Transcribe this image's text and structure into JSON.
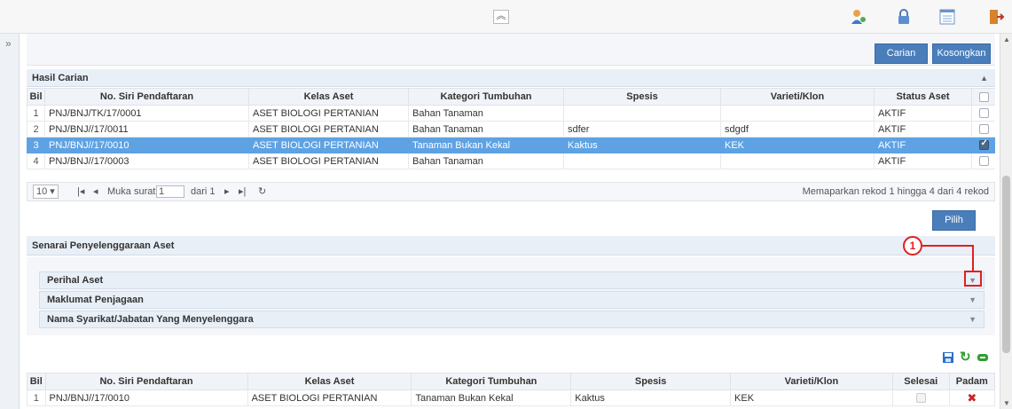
{
  "topbar": {
    "collapse_glyph": "︽",
    "icons": [
      "user-settings-icon",
      "lock-icon",
      "list-window-icon",
      "logout-icon"
    ]
  },
  "sidebar": {
    "expand_glyph": "»"
  },
  "actions": {
    "search_label": "Carian",
    "clear_label": "Kosongkan",
    "select_label": "Pilih"
  },
  "results": {
    "title": "Hasil Carian",
    "columns": [
      "Bil",
      "No. Siri Pendaftaran",
      "Kelas Aset",
      "Kategori Tumbuhan",
      "Spesis",
      "Varieti/Klon",
      "Status Aset"
    ],
    "rows": [
      {
        "bil": "1",
        "no_siri": "PNJ/BNJ/TK/17/0001",
        "kelas": "ASET BIOLOGI PERTANIAN",
        "kategori": "Bahan Tanaman",
        "spesis": "",
        "varieti": "",
        "status": "AKTIF",
        "checked": false,
        "selected": false
      },
      {
        "bil": "2",
        "no_siri": "PNJ/BNJ//17/0011",
        "kelas": "ASET BIOLOGI PERTANIAN",
        "kategori": "Bahan Tanaman",
        "spesis": "sdfer",
        "varieti": "sdgdf",
        "status": "AKTIF",
        "checked": false,
        "selected": false
      },
      {
        "bil": "3",
        "no_siri": "PNJ/BNJ//17/0010",
        "kelas": "ASET BIOLOGI PERTANIAN",
        "kategori": "Tanaman Bukan Kekal",
        "spesis": "Kaktus",
        "varieti": "KEK",
        "status": "AKTIF",
        "checked": true,
        "selected": true
      },
      {
        "bil": "4",
        "no_siri": "PNJ/BNJ//17/0003",
        "kelas": "ASET BIOLOGI PERTANIAN",
        "kategori": "Bahan Tanaman",
        "spesis": "",
        "varieti": "",
        "status": "AKTIF",
        "checked": false,
        "selected": false
      }
    ],
    "pager": {
      "page_size": "10 ▾",
      "page_label": "Muka surat",
      "page_value": "1",
      "of_label": "dari 1",
      "summary": "Memaparkan rekod 1 hingga 4 dari 4 rekod"
    }
  },
  "maintenance": {
    "title": "Senarai Penyelenggaraan Aset",
    "panels": [
      "Perihal Aset",
      "Maklumat Penjagaan",
      "Nama Syarikat/Jabatan Yang Menyelenggara"
    ],
    "callout_number": "1"
  },
  "detail": {
    "columns": [
      "Bil",
      "No. Siri Pendaftaran",
      "Kelas Aset",
      "Kategori Tumbuhan",
      "Spesis",
      "Varieti/Klon",
      "Selesai",
      "Padam"
    ],
    "rows": [
      {
        "bil": "1",
        "no_siri": "PNJ/BNJ//17/0010",
        "kelas": "ASET BIOLOGI PERTANIAN",
        "kategori": "Tanaman Bukan Kekal",
        "spesis": "Kaktus",
        "varieti": "KEK",
        "delete_glyph": "✖"
      }
    ]
  },
  "colors": {
    "accent": "#4a7ebb",
    "selected_row": "#5ea2e4",
    "callout": "#e02020",
    "save_icon": "#2a6fc9",
    "refresh_icon": "#2f9e2f",
    "delete_icon": "#cc2222"
  }
}
